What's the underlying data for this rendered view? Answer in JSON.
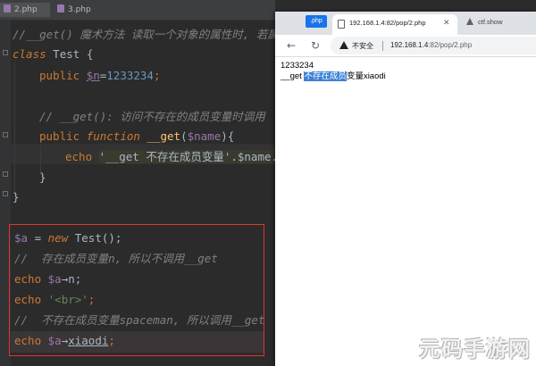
{
  "ide": {
    "tabs": [
      {
        "label": "2.php"
      },
      {
        "label": "3.php"
      }
    ],
    "code": {
      "l1": "//__get() 魔术方法 读取一个对象的属性时, 若属性",
      "l2_kw": "class",
      "l2_name": "Test",
      "l2_brace": "{",
      "l3_kw": "public",
      "l3_var": "$n",
      "l3_eq": "=",
      "l3_num": "1233234",
      "l3_semi": ";",
      "l4": "// __get(): 访问不存在的成员变量时调用",
      "l5_kw1": "public",
      "l5_kw2": "function",
      "l5_fn": "__get",
      "l5_p1": "(",
      "l5_var": "$name",
      "l5_p2": "){",
      "l6_kw": "echo",
      "l6_str": "'__get 不存在成员变量'",
      "l6_rest": ".$name.'",
      "l7": "}",
      "l8": "}",
      "l9_var": "$a",
      "l9_eq": " = ",
      "l9_kw": "new",
      "l9_rest": " Test();",
      "l10": "//  存在成员变量n, 所以不调用__get",
      "l11_kw": "echo",
      "l11_var": "$a",
      "l11_arrow": "→n;",
      "l12_kw": "echo",
      "l12_str": "'<br>'",
      "l12_semi": ";",
      "l13": "//  不存在成员变量spaceman, 所以调用__get",
      "l14_kw": "echo",
      "l14_var": "$a",
      "l14_arrow": "→",
      "l14_prop": "xiaodi",
      "l14_semi": ";"
    }
  },
  "browser": {
    "page_tab": ".php",
    "active_tab_title": "192.168.1.4:82/pop/2.php",
    "other_tab_title": "ctf.show",
    "address": {
      "security_label": "不安全",
      "host": "192.168.1.4",
      "rest": ":82/pop/2.php"
    },
    "content": {
      "line1": "1233234",
      "line2_prefix": "__get ",
      "line2_selected": "不存在成员",
      "line2_suffix": "变量xiaodi"
    }
  },
  "watermark": "元码手游网",
  "colors": {
    "highlight_box": "#e0362b",
    "selection": "#3e82d6",
    "keyword": "#cc7832",
    "variable": "#9876aa",
    "number": "#6897bb",
    "string": "#6a8759",
    "comment": "#808080"
  }
}
